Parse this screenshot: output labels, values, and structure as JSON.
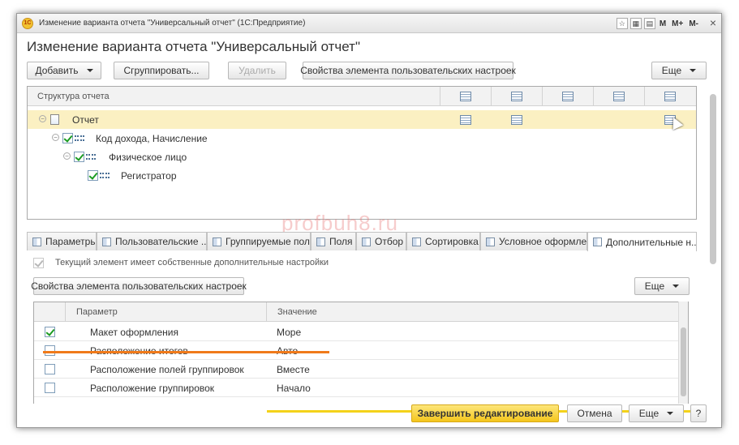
{
  "window": {
    "title": "Изменение варианта отчета \"Универсальный отчет\"  (1С:Предприятие)",
    "app_icon": "1С",
    "toolbar_icons": [
      "favorite-icon",
      "calculator-icon",
      "calendar-icon"
    ],
    "toolbar_text": [
      "M",
      "M+",
      "M-"
    ],
    "close": "×"
  },
  "form": {
    "title": "Изменение варианта отчета \"Универсальный отчет\""
  },
  "toolbar": {
    "add": "Добавить",
    "group": "Сгруппировать...",
    "delete": "Удалить",
    "element_props": "Свойства элемента пользовательских настроек",
    "more": "Еще"
  },
  "structure": {
    "header": "Структура отчета",
    "rows": [
      {
        "label": "Отчет",
        "checked": null,
        "selected": true
      },
      {
        "label": "Код дохода, Начисление",
        "checked": true,
        "selected": false
      },
      {
        "label": "Физическое лицо",
        "checked": true,
        "selected": false
      },
      {
        "label": "Регистратор",
        "checked": true,
        "selected": false
      }
    ]
  },
  "watermark": "profbuh8.ru",
  "tabs": [
    {
      "label": "Параметры",
      "active": false
    },
    {
      "label": "Пользовательские ...",
      "active": false
    },
    {
      "label": "Группируемые поля",
      "active": false
    },
    {
      "label": "Поля",
      "active": false
    },
    {
      "label": "Отбор",
      "active": false
    },
    {
      "label": "Сортировка",
      "active": false
    },
    {
      "label": "Условное оформле...",
      "active": false
    },
    {
      "label": "Дополнительные н...",
      "active": true
    }
  ],
  "additional": {
    "own_settings_label": "Текущий элемент имеет собственные дополнительные настройки",
    "element_props": "Свойства элемента пользовательских настроек",
    "more": "Еще",
    "columns": {
      "param": "Параметр",
      "value": "Значение"
    },
    "rows": [
      {
        "param": "Макет оформления",
        "value": "Море",
        "checked": true
      },
      {
        "param": "Расположение итогов",
        "value": "Авто",
        "checked": false
      },
      {
        "param": "Расположение полей группировок",
        "value": "Вместе",
        "checked": false
      },
      {
        "param": "Расположение группировок",
        "value": "Начало",
        "checked": false
      }
    ]
  },
  "footer": {
    "finish": "Завершить редактирование",
    "cancel": "Отмена",
    "more": "Еще",
    "help": "?"
  },
  "colors": {
    "selected_row": "#fbf0c2",
    "primary_button": "#f4c61d",
    "highlight_underline": "#f07a1a",
    "check_green": "#1b9c22"
  }
}
